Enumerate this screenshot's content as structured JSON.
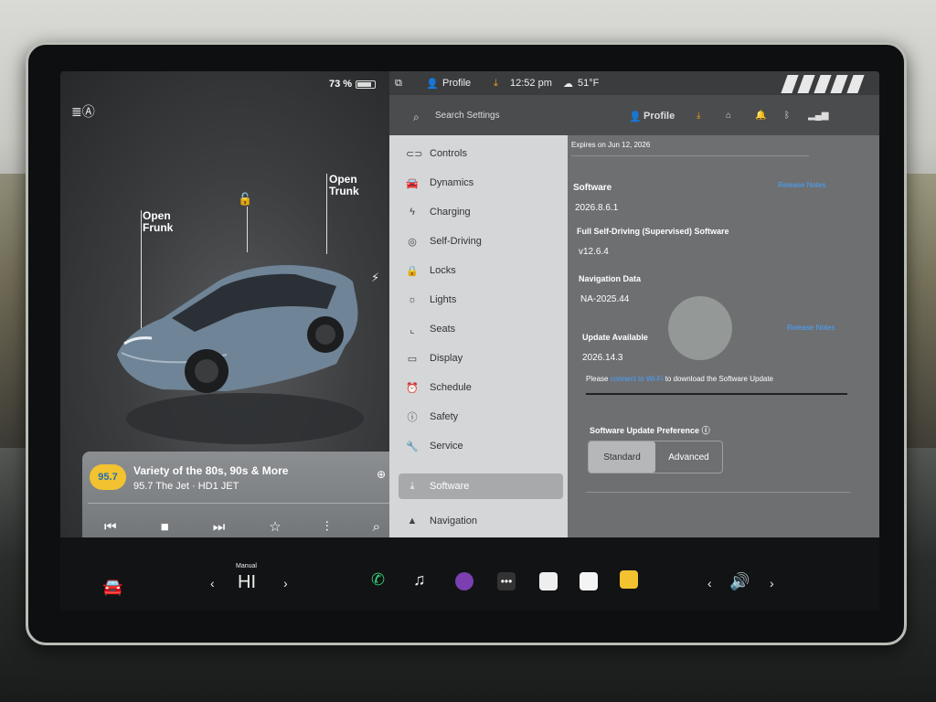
{
  "car": {
    "battery_pct": "73 %",
    "battery_level": 0.73,
    "open_frunk": "Open\nFrunk",
    "open_trunk": "Open\nTrunk"
  },
  "media": {
    "station_logo": "95.7",
    "title": "Variety of the 80s, 90s & More",
    "subtitle": "95.7 The Jet · HD1 JET"
  },
  "topbar": {
    "profile": "Profile",
    "time": "12:52 pm",
    "temp": "51°F"
  },
  "search": {
    "placeholder": "Search Settings",
    "profile": "Profile"
  },
  "nav": {
    "items": [
      {
        "label": "Controls",
        "icon": "toggle-icon"
      },
      {
        "label": "Dynamics",
        "icon": "car-icon"
      },
      {
        "label": "Charging",
        "icon": "bolt-icon"
      },
      {
        "label": "Self-Driving",
        "icon": "steering-wheel-icon"
      },
      {
        "label": "Locks",
        "icon": "lock-icon"
      },
      {
        "label": "Lights",
        "icon": "sun-icon"
      },
      {
        "label": "Seats",
        "icon": "seat-icon"
      },
      {
        "label": "Display",
        "icon": "display-icon"
      },
      {
        "label": "Schedule",
        "icon": "alarm-icon"
      },
      {
        "label": "Safety",
        "icon": "info-icon"
      },
      {
        "label": "Service",
        "icon": "wrench-icon"
      },
      {
        "label": "Software",
        "icon": "download-icon"
      },
      {
        "label": "Navigation",
        "icon": "navigation-icon"
      }
    ],
    "active": "Software"
  },
  "software": {
    "expires": "Expires on Jun 12, 2026",
    "software_label": "Software",
    "software_version": "2026.8.6.1",
    "release_notes": "Release Notes",
    "fsd_label": "Full Self-Driving (Supervised) Software",
    "fsd_version": "v12.6.4",
    "nav_label": "Navigation Data",
    "nav_version": "NA-2025.44",
    "update_label": "Update Available",
    "update_version": "2026.14.3",
    "update_msg_pre": "Please ",
    "update_msg_link": "connect to Wi-Fi",
    "update_msg_post": " to download the Software Update",
    "pref_label": "Software Update Preference",
    "pref_standard": "Standard",
    "pref_advanced": "Advanced",
    "pref_selected": "Standard"
  },
  "taskbar": {
    "gear_label": "Manual",
    "gear_value": "HI"
  }
}
